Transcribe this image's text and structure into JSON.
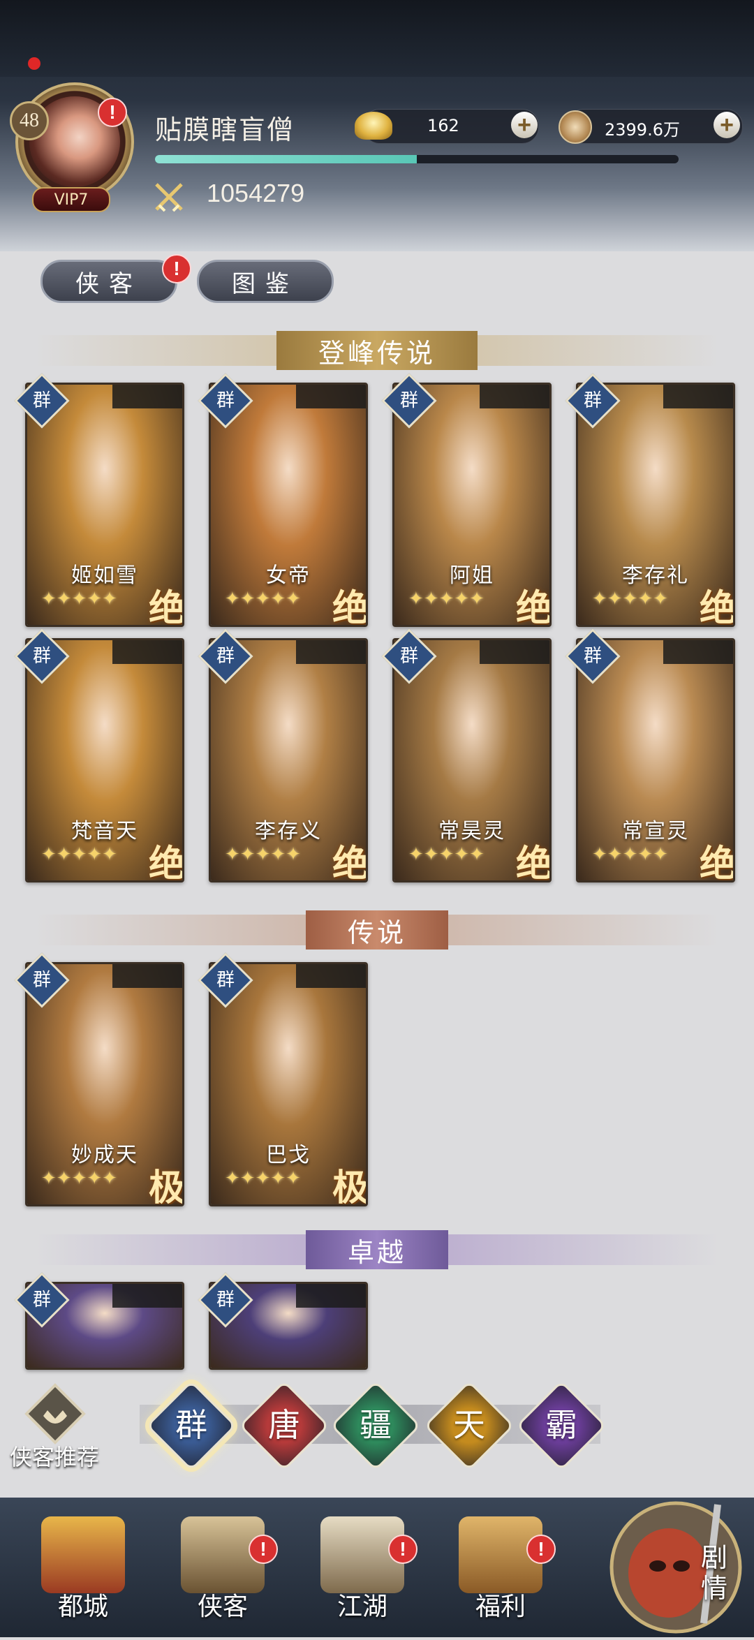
{
  "player": {
    "level": "48",
    "vip": "VIP7",
    "name": "贴膜瞎盲僧",
    "gold": "162",
    "coins": "2399.6万",
    "power": "1054279",
    "xp_fraction": 0.5
  },
  "tabs": [
    {
      "label": "侠客",
      "active": true
    },
    {
      "label": "图鉴",
      "active": false
    }
  ],
  "sections": [
    {
      "title": "登峰传说",
      "heroes": [
        {
          "faction": "群",
          "name": "姬如雪",
          "stars": 5,
          "grade": "绝",
          "color": "#c48a3a"
        },
        {
          "faction": "群",
          "name": "女帝",
          "stars": 5,
          "grade": "绝",
          "color": "#c07a3a"
        },
        {
          "faction": "群",
          "name": "阿姐",
          "stars": 5,
          "grade": "绝",
          "color": "#b9874a"
        },
        {
          "faction": "群",
          "name": "李存礼",
          "stars": 5,
          "grade": "绝",
          "color": "#b78a4c"
        },
        {
          "faction": "群",
          "name": "梵音天",
          "stars": 5,
          "grade": "绝",
          "color": "#c48a3a"
        },
        {
          "faction": "群",
          "name": "李存义",
          "stars": 5,
          "grade": "绝",
          "color": "#b07f45"
        },
        {
          "faction": "群",
          "name": "常昊灵",
          "stars": 5,
          "grade": "绝",
          "color": "#a57a45"
        },
        {
          "faction": "群",
          "name": "常宣灵",
          "stars": 5,
          "grade": "绝",
          "color": "#b98a52"
        }
      ]
    },
    {
      "title": "传说",
      "heroes": [
        {
          "faction": "群",
          "name": "妙成天",
          "stars": 5,
          "grade": "极",
          "color": "#b07a40"
        },
        {
          "faction": "群",
          "name": "巴戈",
          "stars": 5,
          "grade": "极",
          "color": "#a8763c"
        }
      ]
    },
    {
      "title": "卓越",
      "heroes": [
        {
          "faction": "群",
          "name": "",
          "stars": 0,
          "grade": "",
          "color": "#5d4a86"
        },
        {
          "faction": "群",
          "name": "",
          "stars": 0,
          "grade": "",
          "color": "#4d3f78"
        }
      ]
    }
  ],
  "recommend_label": "侠客推荐",
  "factions": [
    {
      "label": "群",
      "color": "#3a5b93",
      "selected": true
    },
    {
      "label": "唐",
      "color": "#b53a3a",
      "selected": false
    },
    {
      "label": "疆",
      "color": "#2e8a5c",
      "selected": false
    },
    {
      "label": "天",
      "color": "#c48b1e",
      "selected": false
    },
    {
      "label": "霸",
      "color": "#6a3d98",
      "selected": false
    }
  ],
  "nav": [
    {
      "label": "都城",
      "alert": false
    },
    {
      "label": "侠客",
      "alert": true
    },
    {
      "label": "江湖",
      "alert": true
    },
    {
      "label": "福利",
      "alert": true
    }
  ],
  "story_label": "剧情"
}
